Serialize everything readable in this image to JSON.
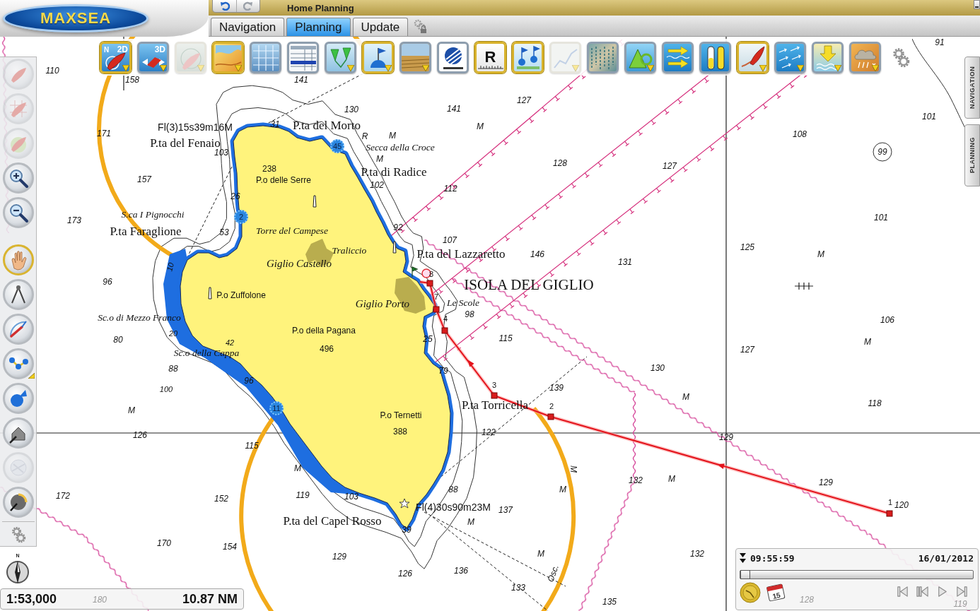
{
  "header": {
    "logo": "MAXSEA",
    "title": "Home Planning",
    "history": [
      {
        "kind": "undo",
        "disabled": false
      },
      {
        "kind": "redo",
        "disabled": true
      }
    ]
  },
  "tabs": [
    {
      "label": "Navigation",
      "selected": false
    },
    {
      "label": "Planning",
      "selected": true
    },
    {
      "label": "Update",
      "selected": false
    }
  ],
  "toolbar": {
    "items": [
      {
        "kind": "view-2d",
        "mark": "N",
        "label": "2D",
        "selected": true,
        "disabled": false,
        "menu": true
      },
      {
        "kind": "view-3d",
        "label": "3D",
        "selected": false,
        "disabled": false,
        "menu": true
      },
      {
        "kind": "radar",
        "selected": false,
        "disabled": true,
        "menu": true
      },
      {
        "kind": "chart",
        "selected": true,
        "disabled": false,
        "menu": true
      },
      {
        "kind": "grid",
        "selected": false,
        "disabled": false,
        "menu": false
      },
      {
        "kind": "table",
        "selected": false,
        "disabled": false,
        "menu": false
      },
      {
        "kind": "markers",
        "selected": false,
        "disabled": false,
        "menu": true
      },
      {
        "kind": "buoy",
        "selected": true,
        "disabled": false,
        "menu": true
      },
      {
        "kind": "photo",
        "selected": false,
        "disabled": false,
        "menu": true
      },
      {
        "kind": "disc",
        "selected": false,
        "disabled": false,
        "menu": false
      },
      {
        "kind": "ruler",
        "label": "R",
        "selected": true,
        "disabled": false,
        "menu": false
      },
      {
        "kind": "flags",
        "selected": true,
        "disabled": false,
        "menu": false
      },
      {
        "kind": "graph",
        "selected": false,
        "disabled": true,
        "menu": true
      },
      {
        "kind": "satellite",
        "selected": false,
        "disabled": false,
        "menu": false
      },
      {
        "kind": "shapes",
        "selected": false,
        "disabled": false,
        "menu": true
      },
      {
        "kind": "arrows",
        "selected": false,
        "disabled": false,
        "menu": false
      },
      {
        "kind": "gauge",
        "selected": false,
        "disabled": false,
        "menu": false
      },
      {
        "kind": "boat",
        "selected": true,
        "disabled": false,
        "menu": true
      },
      {
        "kind": "currents",
        "selected": false,
        "disabled": false,
        "menu": true
      },
      {
        "kind": "download",
        "selected": false,
        "disabled": false,
        "menu": true
      },
      {
        "kind": "weather",
        "selected": false,
        "disabled": false,
        "menu": true
      }
    ]
  },
  "side_tools": {
    "items": [
      {
        "kind": "boat",
        "selected": false,
        "disabled": true,
        "menu": false
      },
      {
        "kind": "boat-chart",
        "selected": false,
        "disabled": true,
        "menu": false
      },
      {
        "kind": "boat-map",
        "selected": false,
        "disabled": true,
        "menu": false
      },
      {
        "kind": "zoom-in",
        "selected": false,
        "disabled": false,
        "menu": false
      },
      {
        "kind": "zoom-out",
        "selected": false,
        "disabled": false,
        "menu": false
      },
      {
        "kind": "hand",
        "selected": true,
        "disabled": false,
        "menu": false
      },
      {
        "kind": "dividers",
        "selected": false,
        "disabled": false,
        "menu": false
      },
      {
        "kind": "measure",
        "selected": false,
        "disabled": false,
        "menu": false
      },
      {
        "kind": "routing",
        "selected": false,
        "disabled": false,
        "menu": true
      },
      {
        "kind": "route",
        "selected": false,
        "disabled": false,
        "menu": false
      },
      {
        "kind": "home",
        "selected": false,
        "disabled": false,
        "menu": false
      },
      {
        "kind": "layers",
        "selected": false,
        "disabled": true,
        "menu": false
      },
      {
        "kind": "dial",
        "selected": false,
        "disabled": false,
        "menu": false
      }
    ]
  },
  "side_tabs": [
    {
      "label": "NAVIGATION"
    },
    {
      "label": "PLANNING"
    }
  ],
  "chart": {
    "labels": [
      {
        "text": "91",
        "kind": "depth"
      },
      {
        "text": "110",
        "kind": "depth"
      },
      {
        "text": "158",
        "kind": "depth"
      },
      {
        "text": "141",
        "kind": "depth"
      },
      {
        "text": "127",
        "kind": "depth"
      },
      {
        "text": "130",
        "kind": "depth"
      },
      {
        "text": "141",
        "kind": "depth"
      },
      {
        "text": "101",
        "kind": "depth"
      },
      {
        "text": "Fl(3)15s39m16M",
        "kind": "light"
      },
      {
        "text": "31",
        "kind": "depth"
      },
      {
        "text": "P.ta del Morto",
        "kind": "place"
      },
      {
        "text": "M",
        "kind": "seabed"
      },
      {
        "text": "171",
        "kind": "depth"
      },
      {
        "text": "R",
        "kind": "seabed"
      },
      {
        "text": "M",
        "kind": "seabed"
      },
      {
        "text": "108",
        "kind": "depth"
      },
      {
        "text": "P.ta del Fenaio",
        "kind": "place"
      },
      {
        "text": "45",
        "kind": "badge"
      },
      {
        "text": "Secca della Croce",
        "kind": "italic"
      },
      {
        "text": "103",
        "kind": "depth"
      },
      {
        "text": "99",
        "kind": "depth"
      },
      {
        "text": "M",
        "kind": "seabed"
      },
      {
        "text": "238",
        "kind": "height"
      },
      {
        "text": "P.ta di Radice",
        "kind": "place"
      },
      {
        "text": "128",
        "kind": "depth"
      },
      {
        "text": "127",
        "kind": "depth"
      },
      {
        "text": "157",
        "kind": "depth"
      },
      {
        "text": "P.o delle Serre",
        "kind": "peak"
      },
      {
        "text": "102",
        "kind": "depth"
      },
      {
        "text": "112",
        "kind": "depth"
      },
      {
        "text": "26",
        "kind": "depth"
      },
      {
        "text": "173",
        "kind": "depth"
      },
      {
        "text": "S.ca I Pignocchi",
        "kind": "italic"
      },
      {
        "text": "2",
        "kind": "badge"
      },
      {
        "text": "101",
        "kind": "depth"
      },
      {
        "text": "P.ta Faraglione",
        "kind": "place"
      },
      {
        "text": "53",
        "kind": "depth"
      },
      {
        "text": "Torre del Campese",
        "kind": "italic"
      },
      {
        "text": "92",
        "kind": "depth"
      },
      {
        "text": "107",
        "kind": "depth"
      },
      {
        "text": "Traliccio",
        "kind": "italic"
      },
      {
        "text": "P.ta del Lazzaretto",
        "kind": "place"
      },
      {
        "text": "146",
        "kind": "depth"
      },
      {
        "text": "125",
        "kind": "depth"
      },
      {
        "text": "M",
        "kind": "seabed"
      },
      {
        "text": "10",
        "kind": "contour"
      },
      {
        "text": "Giglio Castello",
        "kind": "town"
      },
      {
        "text": "131",
        "kind": "depth"
      },
      {
        "text": "96",
        "kind": "depth"
      },
      {
        "text": "ISOLA DEL GIGLIO",
        "kind": "large"
      },
      {
        "text": "P.o Zuffolone",
        "kind": "peak"
      },
      {
        "text": "Giglio Porto",
        "kind": "town"
      },
      {
        "text": "Le Scole",
        "kind": "italic"
      },
      {
        "text": "Sc.o di Mezzo Franco",
        "kind": "italic"
      },
      {
        "text": "98",
        "kind": "depth"
      },
      {
        "text": "106",
        "kind": "depth"
      },
      {
        "text": "20",
        "kind": "contour"
      },
      {
        "text": "P.o della Pagana",
        "kind": "peak"
      },
      {
        "text": "80",
        "kind": "depth"
      },
      {
        "text": "42",
        "kind": "contour"
      },
      {
        "text": "25",
        "kind": "depth"
      },
      {
        "text": "115",
        "kind": "depth"
      },
      {
        "text": "M",
        "kind": "seabed"
      },
      {
        "text": "Sc.o della Cappa",
        "kind": "italic"
      },
      {
        "text": "496",
        "kind": "height"
      },
      {
        "text": "127",
        "kind": "depth"
      },
      {
        "text": "88",
        "kind": "depth"
      },
      {
        "text": "79",
        "kind": "depth"
      },
      {
        "text": "130",
        "kind": "depth"
      },
      {
        "text": "96",
        "kind": "depth"
      },
      {
        "text": "100",
        "kind": "contour"
      },
      {
        "text": "139",
        "kind": "depth"
      },
      {
        "text": "M",
        "kind": "seabed"
      },
      {
        "text": "M",
        "kind": "seabed"
      },
      {
        "text": "11",
        "kind": "badge"
      },
      {
        "text": "P.ta Torricella",
        "kind": "place"
      },
      {
        "text": "118",
        "kind": "depth"
      },
      {
        "text": "P.o Ternetti",
        "kind": "peak"
      },
      {
        "text": "126",
        "kind": "depth"
      },
      {
        "text": "388",
        "kind": "height"
      },
      {
        "text": "122",
        "kind": "depth"
      },
      {
        "text": "129",
        "kind": "depth"
      },
      {
        "text": "115",
        "kind": "depth"
      },
      {
        "text": "M",
        "kind": "seabed"
      },
      {
        "text": "M",
        "kind": "seabed"
      },
      {
        "text": "132",
        "kind": "depth"
      },
      {
        "text": "M",
        "kind": "seabed"
      },
      {
        "text": "129",
        "kind": "depth"
      },
      {
        "text": "88",
        "kind": "depth"
      },
      {
        "text": "M",
        "kind": "seabed"
      },
      {
        "text": "172",
        "kind": "depth"
      },
      {
        "text": "152",
        "kind": "depth"
      },
      {
        "text": "119",
        "kind": "depth"
      },
      {
        "text": "103",
        "kind": "depth"
      },
      {
        "text": "Fl(4)30s90m23M",
        "kind": "light"
      },
      {
        "text": "137",
        "kind": "depth"
      },
      {
        "text": "120",
        "kind": "depth"
      },
      {
        "text": "P.ta del Capel Rosso",
        "kind": "place"
      },
      {
        "text": "M",
        "kind": "seabed"
      },
      {
        "text": "39",
        "kind": "depth"
      },
      {
        "text": "170",
        "kind": "depth"
      },
      {
        "text": "154",
        "kind": "depth"
      },
      {
        "text": "129",
        "kind": "depth"
      },
      {
        "text": "M",
        "kind": "seabed"
      },
      {
        "text": "132",
        "kind": "depth"
      },
      {
        "text": "126",
        "kind": "depth"
      },
      {
        "text": "136",
        "kind": "depth"
      },
      {
        "text": "Osc.",
        "kind": "seabed"
      },
      {
        "text": "133",
        "kind": "depth"
      },
      {
        "text": "180",
        "kind": "faint"
      },
      {
        "text": "135",
        "kind": "depth"
      },
      {
        "text": "128",
        "kind": "faint"
      },
      {
        "text": "119",
        "kind": "faint"
      }
    ],
    "waypoints": [
      {
        "label": "8"
      },
      {
        "label": "7"
      },
      {
        "label": "4"
      },
      {
        "label": "3"
      },
      {
        "label": "2"
      },
      {
        "label": "1"
      }
    ],
    "compass": {
      "label": "N"
    }
  },
  "scale": {
    "ratio": "1:53,000",
    "distance": "10.87 NM"
  },
  "timeline": {
    "time": "09:55:59",
    "date": "16/01/2012",
    "level": 0,
    "calendar_day": "15",
    "controls": [
      {
        "kind": "first"
      },
      {
        "kind": "previous"
      },
      {
        "kind": "play"
      },
      {
        "kind": "last"
      }
    ]
  }
}
